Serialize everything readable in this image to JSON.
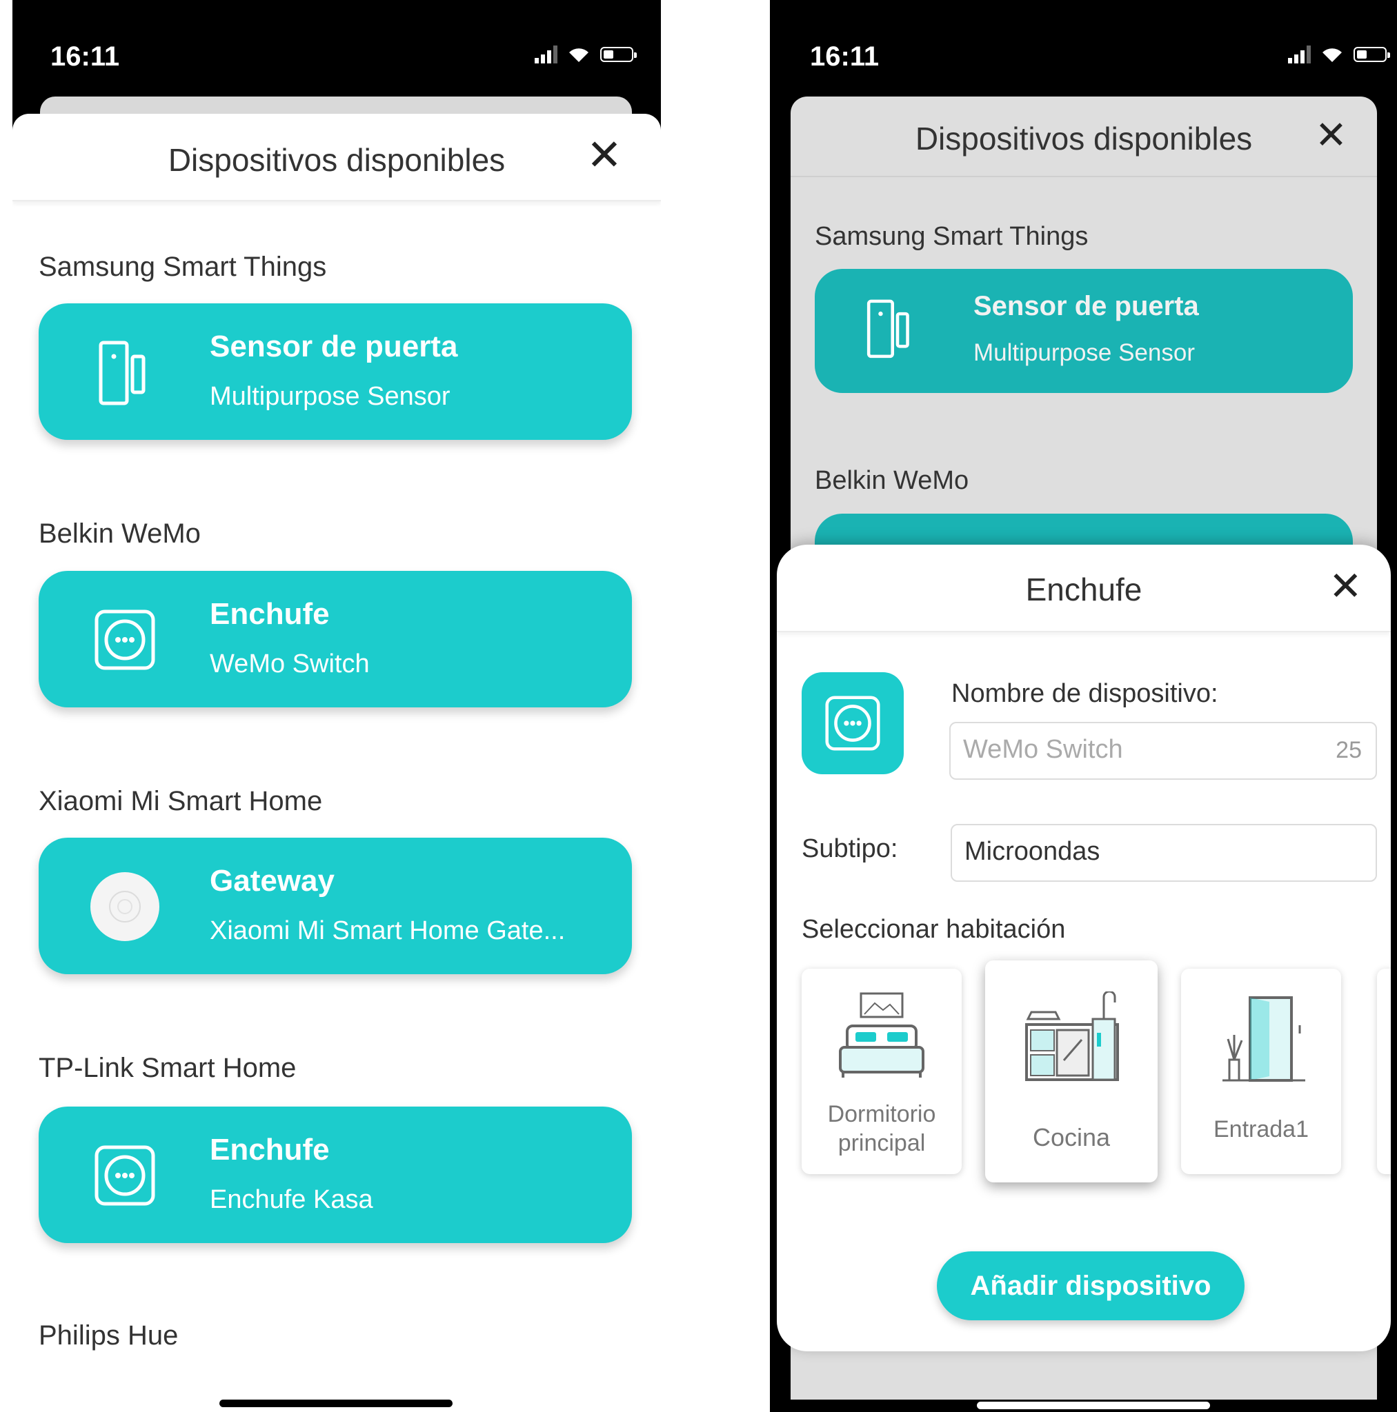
{
  "status": {
    "time": "16:11"
  },
  "list_screen": {
    "title": "Dispositivos disponibles",
    "sections": [
      {
        "name": "Samsung Smart Things",
        "device": {
          "name": "Sensor de puerta",
          "model": "Multipurpose Sensor",
          "icon": "door-sensor-icon"
        }
      },
      {
        "name": "Belkin WeMo",
        "device": {
          "name": "Enchufe",
          "model": "WeMo Switch",
          "icon": "plug-icon"
        }
      },
      {
        "name": "Xiaomi Mi Smart Home",
        "device": {
          "name": "Gateway",
          "model": "Xiaomi Mi Smart Home Gate...",
          "icon": "gateway-icon"
        }
      },
      {
        "name": "TP-Link Smart Home",
        "device": {
          "name": "Enchufe",
          "model": "Enchufe Kasa",
          "icon": "plug-icon"
        }
      },
      {
        "name": "Philips Hue"
      }
    ]
  },
  "modal": {
    "title": "Enchufe",
    "name_label": "Nombre de dispositivo:",
    "name_placeholder": "WeMo Switch",
    "name_counter": "25",
    "subtype_label": "Subtipo:",
    "subtype_value": "Microondas",
    "room_label": "Seleccionar habitación",
    "rooms": [
      {
        "label": "Dormitorio principal",
        "icon": "bedroom-icon"
      },
      {
        "label": "Cocina",
        "icon": "kitchen-icon",
        "selected": true
      },
      {
        "label": "Entrada1",
        "icon": "entrance-icon"
      }
    ],
    "add_button": "Añadir dispositivo"
  },
  "colors": {
    "accent": "#1ccccc",
    "accent_dim": "#1ab3b3",
    "overlay": "#dedede"
  }
}
